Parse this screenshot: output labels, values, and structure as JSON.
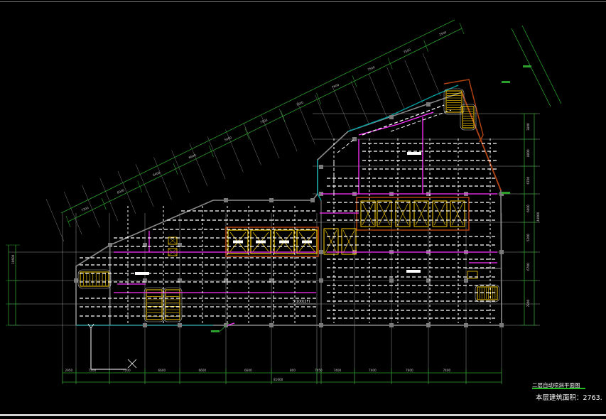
{
  "drawing": {
    "title": "二层自动喷淋平面图",
    "area_label": "本层建筑面积：2763.",
    "elevation_note": "5.100(2F)",
    "vertical_total": "44000",
    "left_total": "19600",
    "bottom_total": "81600"
  },
  "bottom_dims": [
    "2950",
    "7200",
    "7200",
    "6600",
    "6600",
    "6600",
    "800",
    "7450",
    "7400",
    "7400",
    "7600",
    "7400"
  ],
  "right_dims": [
    "3800",
    "8000",
    "6700",
    "6000",
    "5200",
    "6700",
    "7800"
  ],
  "diag_dims": [
    "7300",
    "8000",
    "6400",
    "6600",
    "5000",
    "7500",
    "7500",
    "7600",
    "7500",
    "7500",
    "2500"
  ],
  "colors": {
    "sprinkler_line": "#ffffff",
    "branch_pipe": "#ff30ff",
    "wall": "#8a8a8a",
    "dimension": "#2ca02c",
    "grid": "#9a9a9a",
    "stair": "#ffd000",
    "elevator": "#ffd000",
    "core_wall": "#b04010",
    "teal": "#00a0a0"
  }
}
